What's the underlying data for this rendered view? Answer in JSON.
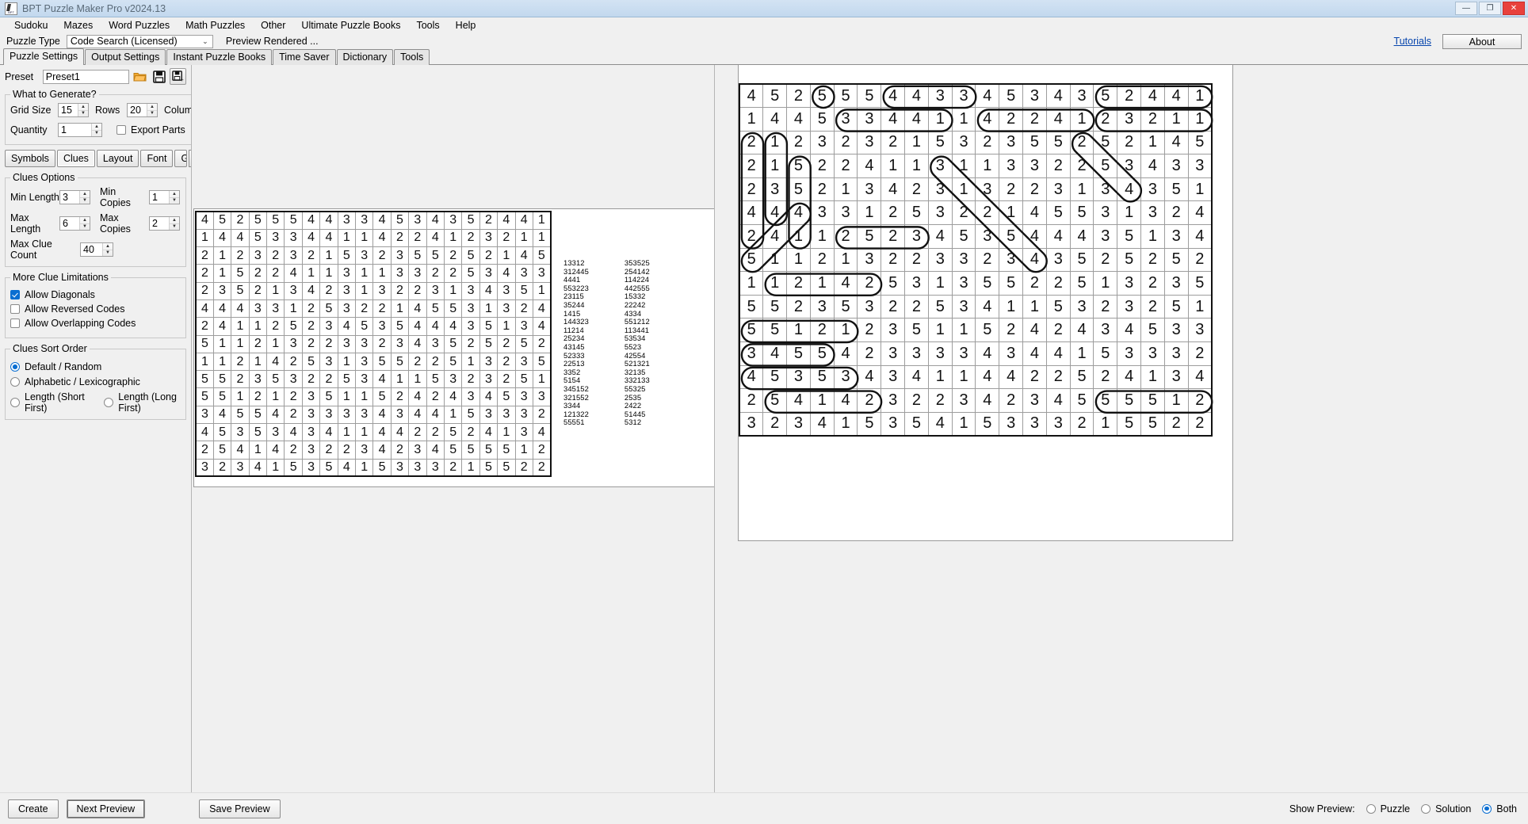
{
  "window": {
    "title": "BPT Puzzle Maker Pro v2024.13",
    "icon": "bpt-app-icon",
    "buttons": {
      "minimize": "—",
      "maximize": "❐",
      "close": "✕"
    }
  },
  "menubar": {
    "items": [
      "Sudoku",
      "Mazes",
      "Word Puzzles",
      "Math Puzzles",
      "Other",
      "Ultimate Puzzle Books",
      "Tools",
      "Help"
    ]
  },
  "puzzle_type_row": {
    "label": "Puzzle Type",
    "value": "Code Search (Licensed)",
    "chevron": "⌄",
    "preview_rendered": "Preview Rendered ...",
    "tutorials": "Tutorials",
    "about": "About"
  },
  "main_tabs": {
    "items": [
      "Puzzle Settings",
      "Output Settings",
      "Instant Puzzle Books",
      "Time Saver",
      "Dictionary",
      "Tools"
    ],
    "active": "Puzzle Settings"
  },
  "preset": {
    "label": "Preset",
    "value": "Preset1",
    "open_icon": "folder-open-icon",
    "save_icon": "floppy-save-icon",
    "saveas_icon": "floppy-save-as-icon"
  },
  "what_to_generate": {
    "legend": "What to Generate?",
    "grid_size_label": "Grid Size",
    "grid_size_value": "15",
    "rows_label": "Rows",
    "columns_value": "20",
    "columns_label": "Columns",
    "quantity_label": "Quantity",
    "quantity_value": "1",
    "export_parts_label": "Export Parts",
    "export_parts_checked": false
  },
  "sub_tabs": {
    "items": [
      "Symbols",
      "Clues",
      "Layout",
      "Font",
      "Grid Styling"
    ],
    "active": "Clues",
    "prev_arrow": "◄",
    "next_arrow": "►"
  },
  "clues_options": {
    "legend": "Clues Options",
    "min_length_label": "Min Length",
    "min_length_value": "3",
    "min_copies_label": "Min Copies",
    "min_copies_value": "1",
    "max_length_label": "Max Length",
    "max_length_value": "6",
    "max_copies_label": "Max Copies",
    "max_copies_value": "2",
    "max_clue_count_label": "Max Clue Count",
    "max_clue_count_value": "40"
  },
  "more_clue_limitations": {
    "legend": "More Clue Limitations",
    "items": [
      {
        "label": "Allow Diagonals",
        "checked": true
      },
      {
        "label": "Allow Reversed Codes",
        "checked": false
      },
      {
        "label": "Allow Overlapping Codes",
        "checked": false
      }
    ]
  },
  "clues_sort_order": {
    "legend": "Clues Sort Order",
    "items": [
      {
        "label": "Default / Random",
        "selected": true
      },
      {
        "label": "Alphabetic / Lexicographic",
        "selected": false
      },
      {
        "label": "Length (Short First)",
        "selected": false
      },
      {
        "label": "Length (Long First)",
        "selected": false
      }
    ]
  },
  "footer": {
    "create": "Create",
    "next_preview": "Next Preview",
    "save_preview": "Save Preview",
    "show_preview_label": "Show Preview:",
    "options": [
      {
        "label": "Puzzle",
        "selected": false
      },
      {
        "label": "Solution",
        "selected": false
      },
      {
        "label": "Both",
        "selected": true
      }
    ]
  },
  "puzzle": {
    "rows": 15,
    "cols": 20,
    "cells": [
      [
        4,
        5,
        2,
        5,
        5,
        5,
        4,
        4,
        3,
        3,
        4,
        5,
        3,
        4,
        3,
        5,
        2,
        4,
        4,
        1
      ],
      [
        1,
        4,
        4,
        5,
        3,
        3,
        4,
        4,
        1,
        1,
        4,
        2,
        2,
        4,
        1,
        2,
        3,
        2,
        1,
        1
      ],
      [
        2,
        1,
        2,
        3,
        2,
        3,
        2,
        1,
        5,
        3,
        2,
        3,
        5,
        5,
        2,
        5,
        2,
        1,
        4,
        5
      ],
      [
        2,
        1,
        5,
        2,
        2,
        4,
        1,
        1,
        3,
        1,
        1,
        3,
        3,
        2,
        2,
        5,
        3,
        4,
        3,
        3
      ],
      [
        2,
        3,
        5,
        2,
        1,
        3,
        4,
        2,
        3,
        1,
        3,
        2,
        2,
        3,
        1,
        3,
        4,
        3,
        5,
        1
      ],
      [
        4,
        4,
        4,
        3,
        3,
        1,
        2,
        5,
        3,
        2,
        2,
        1,
        4,
        5,
        5,
        3,
        1,
        3,
        2,
        4
      ],
      [
        2,
        4,
        1,
        1,
        2,
        5,
        2,
        3,
        4,
        5,
        3,
        5,
        4,
        4,
        4,
        3,
        5,
        1,
        3,
        4
      ],
      [
        5,
        1,
        1,
        2,
        1,
        3,
        2,
        2,
        3,
        3,
        2,
        3,
        4,
        3,
        5,
        2,
        5,
        2,
        5,
        2
      ],
      [
        1,
        1,
        2,
        1,
        4,
        2,
        5,
        3,
        1,
        3,
        5,
        5,
        2,
        2,
        5,
        1,
        3,
        2,
        3,
        5
      ],
      [
        5,
        5,
        2,
        3,
        5,
        3,
        2,
        2,
        5,
        3,
        4,
        1,
        1,
        5,
        3,
        2,
        3,
        2,
        5,
        1
      ],
      [
        5,
        5,
        1,
        2,
        1,
        2,
        3,
        5,
        1,
        1,
        5,
        2,
        4,
        2,
        4,
        3,
        4,
        5,
        3,
        3
      ],
      [
        3,
        4,
        5,
        5,
        4,
        2,
        3,
        3,
        3,
        3,
        4,
        3,
        4,
        4,
        1,
        5,
        3,
        3,
        3,
        2
      ],
      [
        4,
        5,
        3,
        5,
        3,
        4,
        3,
        4,
        1,
        1,
        4,
        4,
        2,
        2,
        5,
        2,
        4,
        1,
        3,
        4
      ],
      [
        2,
        5,
        4,
        1,
        4,
        2,
        3,
        2,
        2,
        3,
        4,
        2,
        3,
        4,
        5,
        5,
        5,
        5,
        1,
        2
      ],
      [
        3,
        2,
        3,
        4,
        1,
        5,
        3,
        5,
        4,
        1,
        5,
        3,
        3,
        3,
        2,
        1,
        5,
        5,
        2,
        2
      ]
    ],
    "clue_columns": [
      [
        "13312",
        "312445",
        "4441",
        "553223",
        "23115",
        "35244",
        "1415",
        "144323",
        "11214",
        "25234",
        "43145",
        "52333",
        "22513",
        "3352",
        "5154",
        "345152",
        "321552",
        "3344",
        "121322",
        "55551"
      ],
      [
        "353525",
        "254142",
        "114224",
        "442555",
        "15332",
        "22242",
        "4334",
        "551212",
        "113441",
        "53534",
        "5523",
        "42554",
        "521321",
        "32135",
        "332133",
        "55325",
        "2535",
        "2422",
        "51445",
        "5312"
      ]
    ]
  },
  "solution": {
    "rows": 15,
    "cols": 20,
    "cells": [
      [
        4,
        5,
        2,
        5,
        5,
        5,
        4,
        4,
        3,
        3,
        4,
        5,
        3,
        4,
        3,
        5,
        2,
        4,
        4,
        1
      ],
      [
        1,
        4,
        4,
        5,
        3,
        3,
        4,
        4,
        1,
        1,
        4,
        2,
        2,
        4,
        1,
        2,
        3,
        2,
        1,
        1
      ],
      [
        2,
        1,
        2,
        3,
        2,
        3,
        2,
        1,
        5,
        3,
        2,
        3,
        5,
        5,
        2,
        5,
        2,
        1,
        4,
        5
      ],
      [
        2,
        1,
        5,
        2,
        2,
        4,
        1,
        1,
        3,
        1,
        1,
        3,
        3,
        2,
        2,
        5,
        3,
        4,
        3,
        3
      ],
      [
        2,
        3,
        5,
        2,
        1,
        3,
        4,
        2,
        3,
        1,
        3,
        2,
        2,
        3,
        1,
        3,
        4,
        3,
        5,
        1
      ],
      [
        4,
        4,
        4,
        3,
        3,
        1,
        2,
        5,
        3,
        2,
        2,
        1,
        4,
        5,
        5,
        3,
        1,
        3,
        2,
        4
      ],
      [
        2,
        4,
        1,
        1,
        2,
        5,
        2,
        3,
        4,
        5,
        3,
        5,
        4,
        4,
        4,
        3,
        5,
        1,
        3,
        4
      ],
      [
        5,
        1,
        1,
        2,
        1,
        3,
        2,
        2,
        3,
        3,
        2,
        3,
        4,
        3,
        5,
        2,
        5,
        2,
        5,
        2
      ],
      [
        1,
        1,
        2,
        1,
        4,
        2,
        5,
        3,
        1,
        3,
        5,
        5,
        2,
        2,
        5,
        1,
        3,
        2,
        3,
        5
      ],
      [
        5,
        5,
        2,
        3,
        5,
        3,
        2,
        2,
        5,
        3,
        4,
        1,
        1,
        5,
        3,
        2,
        3,
        2,
        5,
        1
      ],
      [
        5,
        5,
        1,
        2,
        1,
        2,
        3,
        5,
        1,
        1,
        5,
        2,
        4,
        2,
        4,
        3,
        4,
        5,
        3,
        3
      ],
      [
        3,
        4,
        5,
        5,
        4,
        2,
        3,
        3,
        3,
        3,
        4,
        3,
        4,
        4,
        1,
        5,
        3,
        3,
        3,
        2
      ],
      [
        4,
        5,
        3,
        5,
        3,
        4,
        3,
        4,
        1,
        1,
        4,
        4,
        2,
        2,
        5,
        2,
        4,
        1,
        3,
        4
      ],
      [
        2,
        5,
        4,
        1,
        4,
        2,
        3,
        2,
        2,
        3,
        4,
        2,
        3,
        4,
        5,
        5,
        5,
        5,
        1,
        2
      ],
      [
        3,
        2,
        3,
        4,
        1,
        5,
        3,
        5,
        4,
        1,
        5,
        3,
        3,
        3,
        2,
        1,
        5,
        5,
        2,
        2
      ]
    ],
    "highlights": [
      {
        "r": 0,
        "c": 3,
        "len": 1,
        "dir": "v",
        "n": 5
      },
      {
        "r": 0,
        "c": 6,
        "len": 4,
        "dir": "h"
      },
      {
        "r": 0,
        "c": 15,
        "len": 5,
        "dir": "h"
      },
      {
        "r": 1,
        "c": 4,
        "len": 5,
        "dir": "h"
      },
      {
        "r": 1,
        "c": 10,
        "len": 5,
        "dir": "h"
      },
      {
        "r": 1,
        "c": 15,
        "len": 5,
        "dir": "h"
      },
      {
        "r": 2,
        "c": 0,
        "len": 5,
        "dir": "v"
      },
      {
        "r": 2,
        "c": 1,
        "len": 4,
        "dir": "v"
      },
      {
        "r": 2,
        "c": 14,
        "len": 3,
        "dir": "d1"
      },
      {
        "r": 3,
        "c": 2,
        "len": 4,
        "dir": "v"
      },
      {
        "r": 3,
        "c": 8,
        "len": 5,
        "dir": "d1"
      },
      {
        "r": 5,
        "c": 2,
        "len": 3,
        "dir": "d2"
      },
      {
        "r": 6,
        "c": 4,
        "len": 4,
        "dir": "h"
      },
      {
        "r": 8,
        "c": 1,
        "len": 5,
        "dir": "h"
      },
      {
        "r": 10,
        "c": 0,
        "len": 5,
        "dir": "h"
      },
      {
        "r": 11,
        "c": 0,
        "len": 4,
        "dir": "h"
      },
      {
        "r": 12,
        "c": 0,
        "len": 5,
        "dir": "h"
      },
      {
        "r": 13,
        "c": 1,
        "len": 5,
        "dir": "h"
      },
      {
        "r": 13,
        "c": 15,
        "len": 5,
        "dir": "h"
      }
    ]
  }
}
